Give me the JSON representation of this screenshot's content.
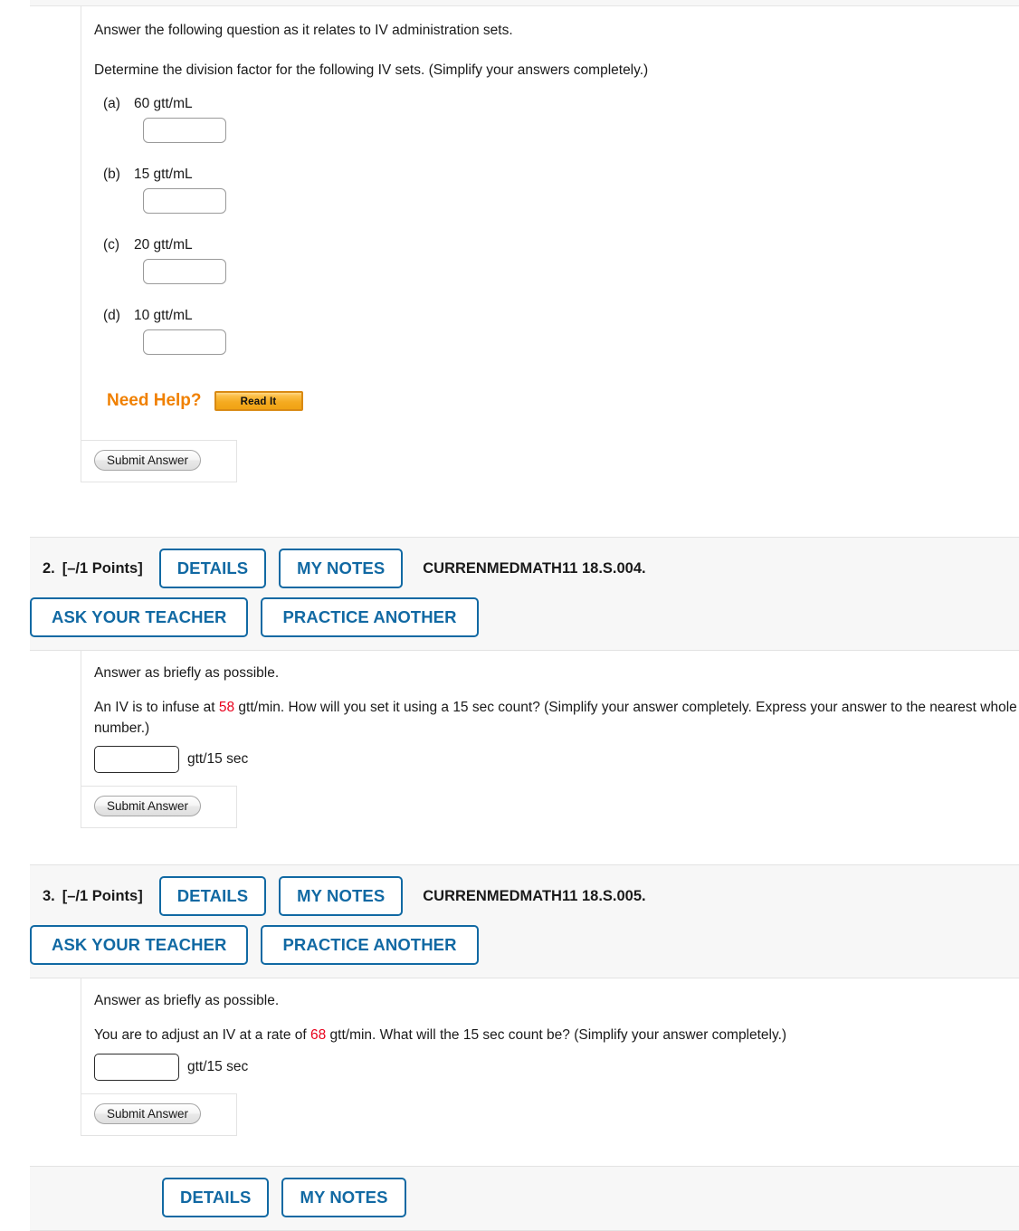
{
  "questions": [
    {
      "id": "q1",
      "partial": true,
      "body": {
        "intro": "Answer the following question as it relates to IV administration sets.",
        "prompt": "Determine the division factor for the following IV sets. (Simplify your answers completely.)",
        "parts": [
          {
            "label": "(a)",
            "value": "60 gtt/mL",
            "answer": ""
          },
          {
            "label": "(b)",
            "value": "15 gtt/mL",
            "answer": ""
          },
          {
            "label": "(c)",
            "value": "20 gtt/mL",
            "answer": ""
          },
          {
            "label": "(d)",
            "value": "10 gtt/mL",
            "answer": ""
          }
        ],
        "need_help_label": "Need Help?",
        "read_it_label": "Read It",
        "submit_label": "Submit Answer"
      }
    },
    {
      "id": "q2",
      "header": {
        "number": "2.",
        "points": "[–/1 Points]",
        "details_label": "DETAILS",
        "my_notes_label": "MY NOTES",
        "code": "CURRENMEDMATH11 18.S.004.",
        "ask_teacher_label": "ASK YOUR TEACHER",
        "practice_another_label": "PRACTICE ANOTHER"
      },
      "body": {
        "intro": "Answer as briefly as possible.",
        "prompt_pre": "An IV is to infuse at ",
        "prompt_rate": "58",
        "prompt_post": " gtt/min. How will you set it using a 15 sec count? (Simplify your answer completely. Express your answer to the nearest whole number.)",
        "answer": "",
        "unit": "gtt/15 sec",
        "submit_label": "Submit Answer"
      }
    },
    {
      "id": "q3",
      "header": {
        "number": "3.",
        "points": "[–/1 Points]",
        "details_label": "DETAILS",
        "my_notes_label": "MY NOTES",
        "code": "CURRENMEDMATH11 18.S.005.",
        "ask_teacher_label": "ASK YOUR TEACHER",
        "practice_another_label": "PRACTICE ANOTHER"
      },
      "body": {
        "intro": "Answer as briefly as possible.",
        "prompt_pre": "You are to adjust an IV at a rate of ",
        "prompt_rate": "68",
        "prompt_post": " gtt/min. What will the 15 sec count be? (Simplify your answer completely.)",
        "answer": "",
        "unit": "gtt/15 sec",
        "submit_label": "Submit Answer"
      }
    },
    {
      "id": "q4",
      "header": {
        "details_label": "DETAILS",
        "my_notes_label": "MY NOTES"
      }
    }
  ],
  "colors": {
    "blue_accent": "#1169a3",
    "orange_accent": "#f08000",
    "red_value": "#e8001c",
    "header_bg": "#f7f7f7",
    "border": "#e3e3e3"
  }
}
